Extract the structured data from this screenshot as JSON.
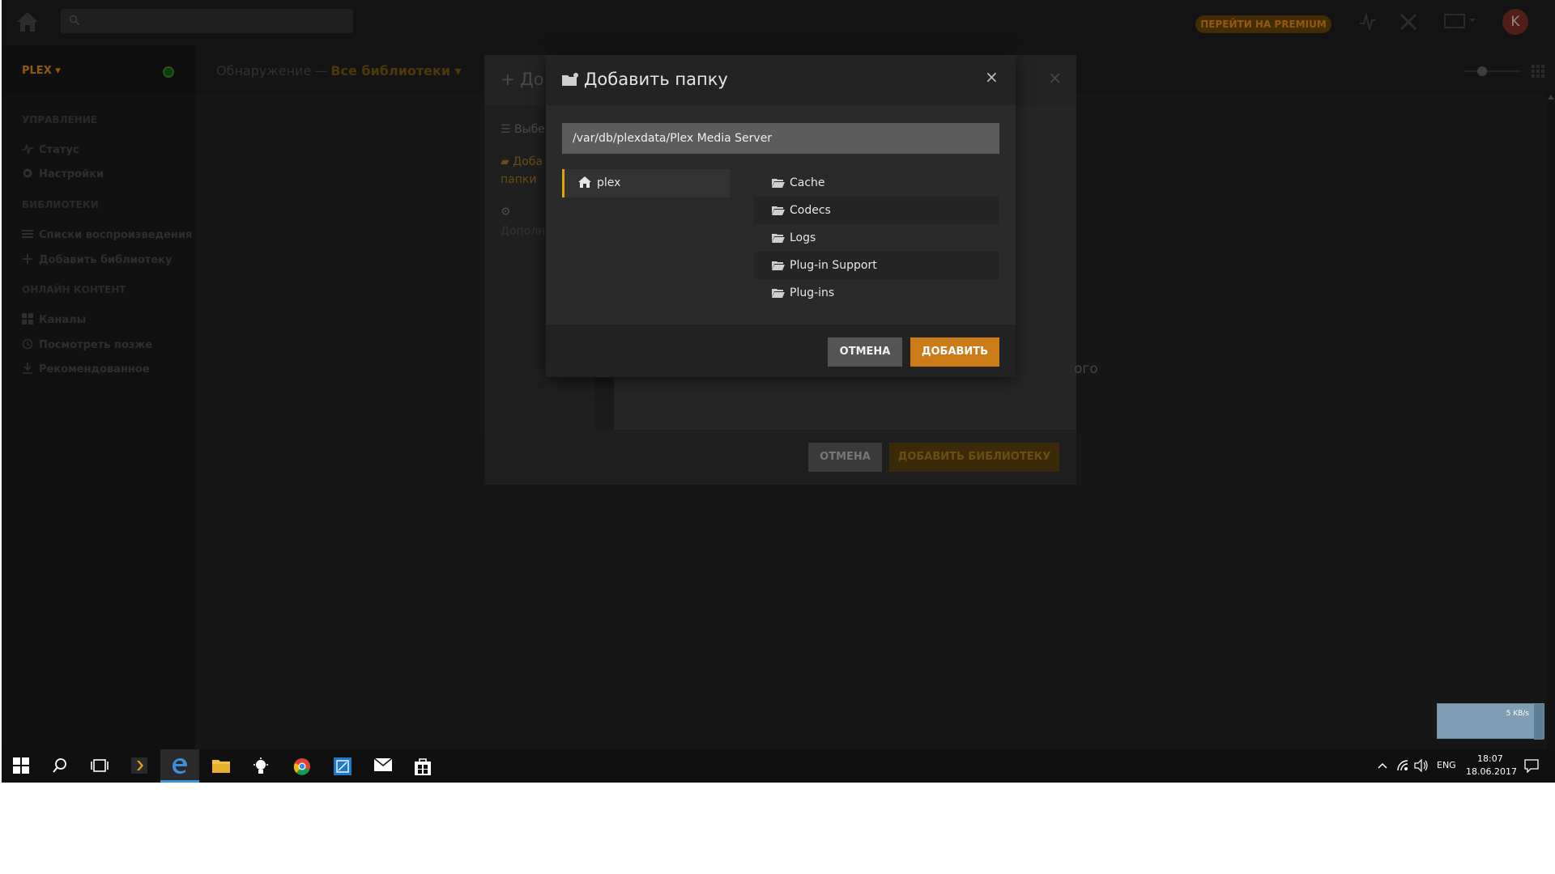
{
  "topbar": {
    "search_placeholder": "",
    "premium_label": "ПЕРЕЙТИ НА PREMIUM",
    "avatar_letter": "K"
  },
  "sidebar": {
    "server_name": "PLEX ▾",
    "sections": {
      "manage": "УПРАВЛЕНИЕ",
      "libraries": "БИБЛИОТЕКИ",
      "online": "ОНЛАЙН КОНТЕНТ"
    },
    "items": {
      "status": "Статус",
      "settings": "Настройки",
      "playlists": "Списки воспроизведения",
      "add_library": "Добавить библиотеку",
      "channels": "Каналы",
      "watch_later": "Посмотреть позже",
      "recommended": "Рекомендованное"
    }
  },
  "main_header": {
    "section": "Обнаружение",
    "separator": "—",
    "library_filter": "Все библиотеки ▾"
  },
  "library_dialog": {
    "title": "До",
    "steps": {
      "select": "Выбе",
      "add_folders_1": "Доба",
      "add_folders_2": "папки",
      "advanced": "Дополн"
    },
    "background_fragment": "ого",
    "cancel_label": "ОТМЕНА",
    "add_label": "ДОБАВИТЬ БИБЛИОТЕКУ"
  },
  "modal": {
    "title": "Добавить папку",
    "close_glyph": "×",
    "path_value": "/var/db/plexdata/Plex Media Server",
    "root_label": "plex",
    "folders": [
      {
        "name": "Cache"
      },
      {
        "name": "Codecs"
      },
      {
        "name": "Logs"
      },
      {
        "name": "Plug-in Support"
      },
      {
        "name": "Plug-ins"
      }
    ],
    "cancel_label": "ОТМЕНА",
    "add_label": "ДОБАВИТЬ"
  },
  "netspeed": {
    "rate": "5 KB/s"
  },
  "taskbar": {
    "language": "ENG",
    "time": "18:07",
    "date": "18.06.2017"
  },
  "colors": {
    "accent": "#cc7b19",
    "plex_yellow": "#e5a00d",
    "taskbar_active": "#3c8fd8"
  }
}
